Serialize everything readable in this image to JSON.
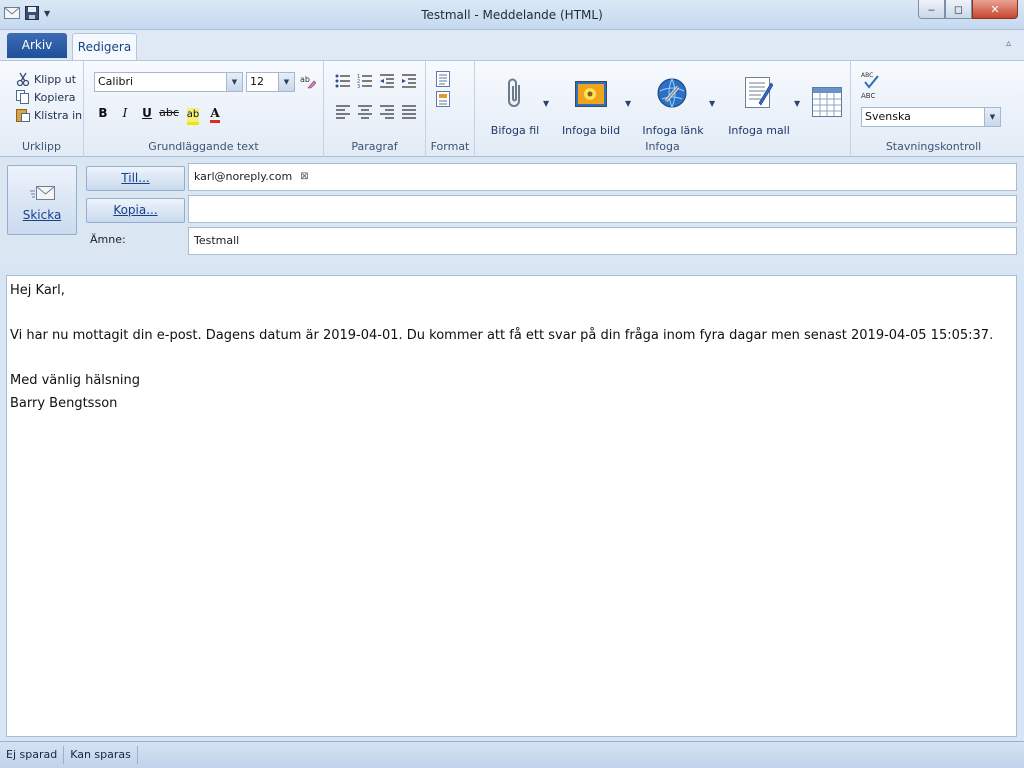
{
  "window": {
    "title": "Testmall - Meddelande (HTML)",
    "controls": {
      "minimize": "‒",
      "maximize": "◻",
      "close": "✕"
    }
  },
  "tabs": {
    "file": "Arkiv",
    "edit": "Redigera",
    "collapse_icon": "▵"
  },
  "ribbon": {
    "clipboard": {
      "label": "Urklipp",
      "cut": "Klipp ut",
      "copy": "Kopiera",
      "paste": "Klistra in"
    },
    "basic_text": {
      "label": "Grundläggande text",
      "font": "Calibri",
      "size": "12",
      "bold": "B",
      "italic": "I",
      "underline": "U",
      "strike": "abc",
      "highlight": "ab",
      "font_color": "A"
    },
    "paragraph": {
      "label": "Paragraf"
    },
    "format": {
      "label": "Format"
    },
    "insert": {
      "label": "Infoga",
      "attach": "Bifoga fil",
      "picture": "Infoga bild",
      "link": "Infoga länk",
      "template": "Infoga mall"
    },
    "spelling": {
      "label": "Stavningskontroll",
      "abc_top": "ABC",
      "abc_bottom": "ABC",
      "language": "Svenska"
    }
  },
  "compose": {
    "send": "Skicka",
    "to_button": "Till...",
    "cc_button": "Kopia...",
    "subject_label": "Ämne:",
    "to_value": "karl@noreply.com",
    "cc_value": "",
    "subject_value": "Testmall"
  },
  "body": {
    "greeting": "Hej Karl,",
    "paragraph": "Vi har nu mottagit din e-post. Dagens datum är 2019-04-01. Du kommer att få ett svar på din fråga inom fyra dagar men senast 2019-04-05 15:05:37.",
    "closing": "Med vänlig hälsning",
    "signature": "Barry Bengtsson"
  },
  "status": {
    "saved": "Ej sparad",
    "saveable": "Kan sparas"
  }
}
